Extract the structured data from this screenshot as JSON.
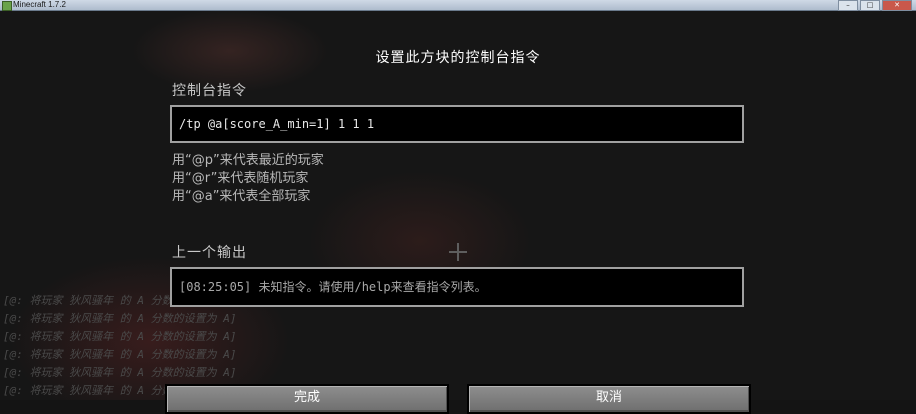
{
  "window": {
    "title": "Minecraft 1.7.2",
    "minimize": "–",
    "maximize": "□",
    "close": "✕"
  },
  "chat": {
    "lines": [
      "[@: 将玩家 狄风骚年 的 A 分数的设置为 A]",
      "[@: 将玩家 狄风骚年 的 A 分数的设置为 A]",
      "[@: 将玩家 狄风骚年 的 A 分数的设置为 A]",
      "[@: 将玩家 狄风骚年 的 A 分数的设置为 A]",
      "[@: 将玩家 狄风骚年 的 A 分数的设置为 A]",
      "[@: 将玩家 狄风骚年 的 A 分数的设置为 A]"
    ]
  },
  "dialog": {
    "heading": "设置此方块的控制台指令",
    "command_label": "控制台指令",
    "command_value": "/tp @a[score_A_min=1] 1 1 1",
    "help": [
      "用“@p”来代表最近的玩家",
      "用“@r”来代表随机玩家",
      "用“@a”来代表全部玩家"
    ],
    "output_label": "上一个输出",
    "output_value": "[08:25:05] 未知指令。请使用/help来查看指令列表。",
    "done_label": "完成",
    "cancel_label": "取消"
  }
}
